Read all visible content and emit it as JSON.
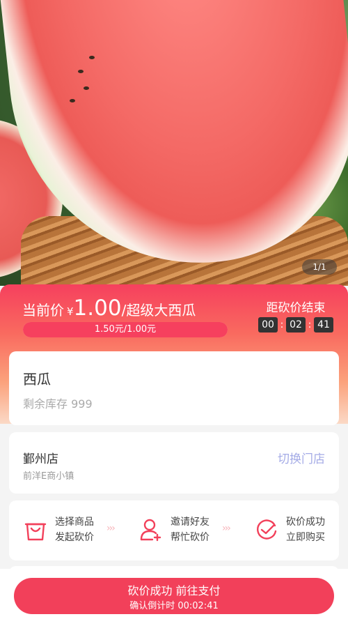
{
  "hero": {
    "image_counter": "1/1"
  },
  "price": {
    "label": "当前价",
    "currency": "¥",
    "value": "1.00",
    "product_suffix": "/超级大西瓜",
    "progress_text": "1.50元/1.00元",
    "progress_fraction": 1.0
  },
  "countdown": {
    "title": "距砍价结束",
    "hours": "00",
    "minutes": "02",
    "seconds": "41",
    "separator": ":"
  },
  "product": {
    "name": "西瓜",
    "stock": "剩余库存 999"
  },
  "store": {
    "name": "鄞州店",
    "address": "前洋E商小镇",
    "switch_label": "切换门店"
  },
  "steps": [
    {
      "line1": "选择商品",
      "line2": "发起砍价",
      "icon": "shopping-bag-icon"
    },
    {
      "line1": "邀请好友",
      "line2": "帮忙砍价",
      "icon": "add-user-icon"
    },
    {
      "line1": "砍价成功",
      "line2": "立即购买",
      "icon": "check-circle-icon"
    }
  ],
  "step_arrows": "›››",
  "cta": {
    "main": "砍价成功 前往支付",
    "sub": "确认倒计时 00:02:41"
  },
  "colors": {
    "accent": "#f2405a",
    "switch": "#a4abe6",
    "arrow": "#f7b4b9"
  }
}
